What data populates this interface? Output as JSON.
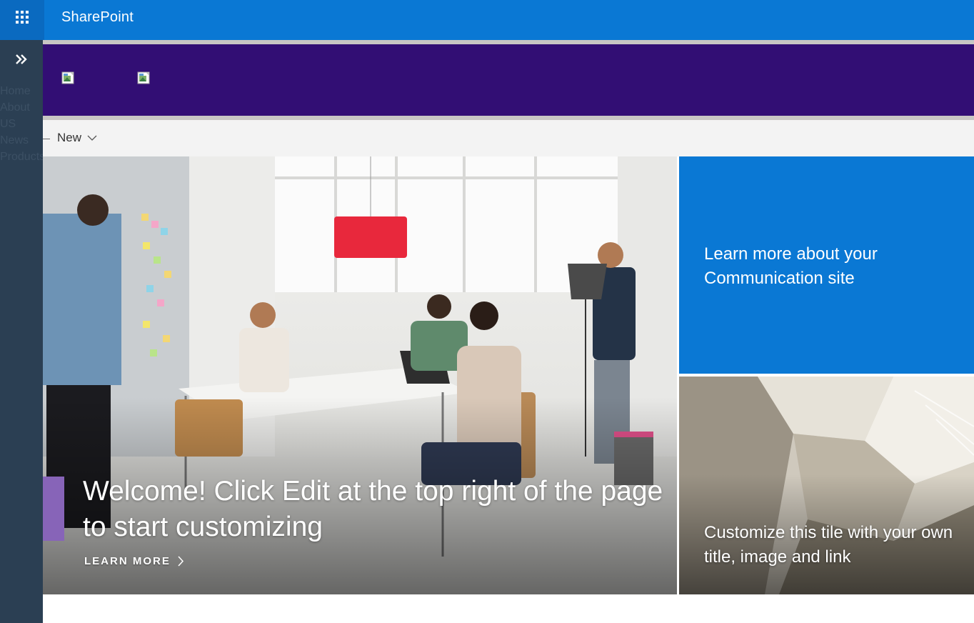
{
  "suitebar": {
    "title": "SharePoint",
    "waffle_icon": "app-launcher-icon"
  },
  "leftnav": {
    "expand_icon": "double-chevron-right-icon",
    "items": [
      {
        "label": "Home"
      },
      {
        "label": "About US"
      },
      {
        "label": "News"
      },
      {
        "label": "Products"
      }
    ]
  },
  "banner": {
    "logo_images": [
      "broken-image-icon",
      "broken-image-icon"
    ]
  },
  "commandbar": {
    "new_label": "New",
    "new_icon": "chevron-down-icon"
  },
  "hero": {
    "main": {
      "title": "Welcome! Click Edit at the top right of the page to start customizing",
      "link_label": "LEARN MORE",
      "link_icon": "chevron-right-icon"
    },
    "tile1": {
      "title": "Learn more about your Communication site"
    },
    "tile2": {
      "title": "Customize this tile with your own title, image and link"
    }
  },
  "colors": {
    "suitebar": "#0a78d4",
    "leftrail": "#2b3f53",
    "banner": "#320e74",
    "accent": "#8764b8",
    "tile_blue": "#0a78d4"
  }
}
